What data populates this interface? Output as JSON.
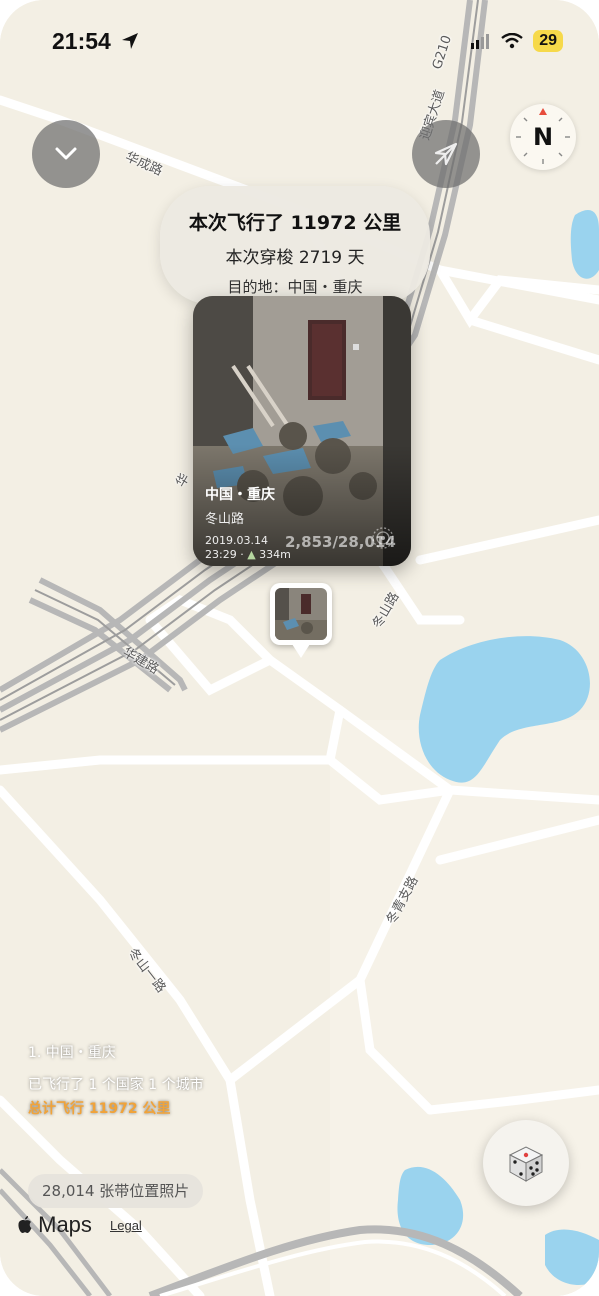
{
  "status_bar": {
    "time": "21:54",
    "battery": "29"
  },
  "map": {
    "road_labels": {
      "huacheng": "华成路",
      "yingbin": "迎宾大道",
      "g210": "G210",
      "hua_side": "华",
      "huajian": "华建路",
      "dongshan": "冬山路",
      "dongqing": "冬青支路",
      "dongshan_1": "冬山一路"
    }
  },
  "trip_info": {
    "title": "本次飞行了 11972 公里",
    "days": "本次穿梭 2719 天",
    "destination": "目的地：中国・重庆"
  },
  "photo_card": {
    "location": "中国・重庆",
    "street": "冬山路",
    "date": "2019.03.14",
    "time": "23:29",
    "altitude": "334m",
    "index": "2,853/28,014"
  },
  "stats": {
    "list_item": "1. 中国・重庆",
    "summary": "已飞行了 1 个国家 1 个城市",
    "total": "总计飞行 11972 公里"
  },
  "photo_count": "28,014 张带位置照片",
  "maps_brand": "Maps",
  "legal": "Legal",
  "icons": {
    "collapse": "chevron-down-icon",
    "location": "location-arrow-icon",
    "compass": "compass-icon",
    "dice": "dice-icon",
    "signal": "signal-icon",
    "wifi": "wifi-icon"
  },
  "colors": {
    "total_accent": "#f0a33a",
    "water": "#9ad3ee",
    "map_bg": "#f3efe4"
  }
}
